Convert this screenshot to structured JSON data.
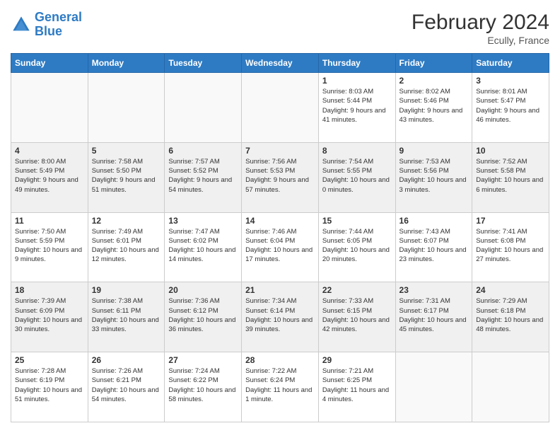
{
  "header": {
    "logo_line1": "General",
    "logo_line2": "Blue",
    "month_year": "February 2024",
    "location": "Ecully, France"
  },
  "days_of_week": [
    "Sunday",
    "Monday",
    "Tuesday",
    "Wednesday",
    "Thursday",
    "Friday",
    "Saturday"
  ],
  "weeks": [
    [
      {
        "day": "",
        "info": ""
      },
      {
        "day": "",
        "info": ""
      },
      {
        "day": "",
        "info": ""
      },
      {
        "day": "",
        "info": ""
      },
      {
        "day": "1",
        "info": "Sunrise: 8:03 AM\nSunset: 5:44 PM\nDaylight: 9 hours\nand 41 minutes."
      },
      {
        "day": "2",
        "info": "Sunrise: 8:02 AM\nSunset: 5:46 PM\nDaylight: 9 hours\nand 43 minutes."
      },
      {
        "day": "3",
        "info": "Sunrise: 8:01 AM\nSunset: 5:47 PM\nDaylight: 9 hours\nand 46 minutes."
      }
    ],
    [
      {
        "day": "4",
        "info": "Sunrise: 8:00 AM\nSunset: 5:49 PM\nDaylight: 9 hours\nand 49 minutes."
      },
      {
        "day": "5",
        "info": "Sunrise: 7:58 AM\nSunset: 5:50 PM\nDaylight: 9 hours\nand 51 minutes."
      },
      {
        "day": "6",
        "info": "Sunrise: 7:57 AM\nSunset: 5:52 PM\nDaylight: 9 hours\nand 54 minutes."
      },
      {
        "day": "7",
        "info": "Sunrise: 7:56 AM\nSunset: 5:53 PM\nDaylight: 9 hours\nand 57 minutes."
      },
      {
        "day": "8",
        "info": "Sunrise: 7:54 AM\nSunset: 5:55 PM\nDaylight: 10 hours\nand 0 minutes."
      },
      {
        "day": "9",
        "info": "Sunrise: 7:53 AM\nSunset: 5:56 PM\nDaylight: 10 hours\nand 3 minutes."
      },
      {
        "day": "10",
        "info": "Sunrise: 7:52 AM\nSunset: 5:58 PM\nDaylight: 10 hours\nand 6 minutes."
      }
    ],
    [
      {
        "day": "11",
        "info": "Sunrise: 7:50 AM\nSunset: 5:59 PM\nDaylight: 10 hours\nand 9 minutes."
      },
      {
        "day": "12",
        "info": "Sunrise: 7:49 AM\nSunset: 6:01 PM\nDaylight: 10 hours\nand 12 minutes."
      },
      {
        "day": "13",
        "info": "Sunrise: 7:47 AM\nSunset: 6:02 PM\nDaylight: 10 hours\nand 14 minutes."
      },
      {
        "day": "14",
        "info": "Sunrise: 7:46 AM\nSunset: 6:04 PM\nDaylight: 10 hours\nand 17 minutes."
      },
      {
        "day": "15",
        "info": "Sunrise: 7:44 AM\nSunset: 6:05 PM\nDaylight: 10 hours\nand 20 minutes."
      },
      {
        "day": "16",
        "info": "Sunrise: 7:43 AM\nSunset: 6:07 PM\nDaylight: 10 hours\nand 23 minutes."
      },
      {
        "day": "17",
        "info": "Sunrise: 7:41 AM\nSunset: 6:08 PM\nDaylight: 10 hours\nand 27 minutes."
      }
    ],
    [
      {
        "day": "18",
        "info": "Sunrise: 7:39 AM\nSunset: 6:09 PM\nDaylight: 10 hours\nand 30 minutes."
      },
      {
        "day": "19",
        "info": "Sunrise: 7:38 AM\nSunset: 6:11 PM\nDaylight: 10 hours\nand 33 minutes."
      },
      {
        "day": "20",
        "info": "Sunrise: 7:36 AM\nSunset: 6:12 PM\nDaylight: 10 hours\nand 36 minutes."
      },
      {
        "day": "21",
        "info": "Sunrise: 7:34 AM\nSunset: 6:14 PM\nDaylight: 10 hours\nand 39 minutes."
      },
      {
        "day": "22",
        "info": "Sunrise: 7:33 AM\nSunset: 6:15 PM\nDaylight: 10 hours\nand 42 minutes."
      },
      {
        "day": "23",
        "info": "Sunrise: 7:31 AM\nSunset: 6:17 PM\nDaylight: 10 hours\nand 45 minutes."
      },
      {
        "day": "24",
        "info": "Sunrise: 7:29 AM\nSunset: 6:18 PM\nDaylight: 10 hours\nand 48 minutes."
      }
    ],
    [
      {
        "day": "25",
        "info": "Sunrise: 7:28 AM\nSunset: 6:19 PM\nDaylight: 10 hours\nand 51 minutes."
      },
      {
        "day": "26",
        "info": "Sunrise: 7:26 AM\nSunset: 6:21 PM\nDaylight: 10 hours\nand 54 minutes."
      },
      {
        "day": "27",
        "info": "Sunrise: 7:24 AM\nSunset: 6:22 PM\nDaylight: 10 hours\nand 58 minutes."
      },
      {
        "day": "28",
        "info": "Sunrise: 7:22 AM\nSunset: 6:24 PM\nDaylight: 11 hours\nand 1 minute."
      },
      {
        "day": "29",
        "info": "Sunrise: 7:21 AM\nSunset: 6:25 PM\nDaylight: 11 hours\nand 4 minutes."
      },
      {
        "day": "",
        "info": ""
      },
      {
        "day": "",
        "info": ""
      }
    ]
  ]
}
